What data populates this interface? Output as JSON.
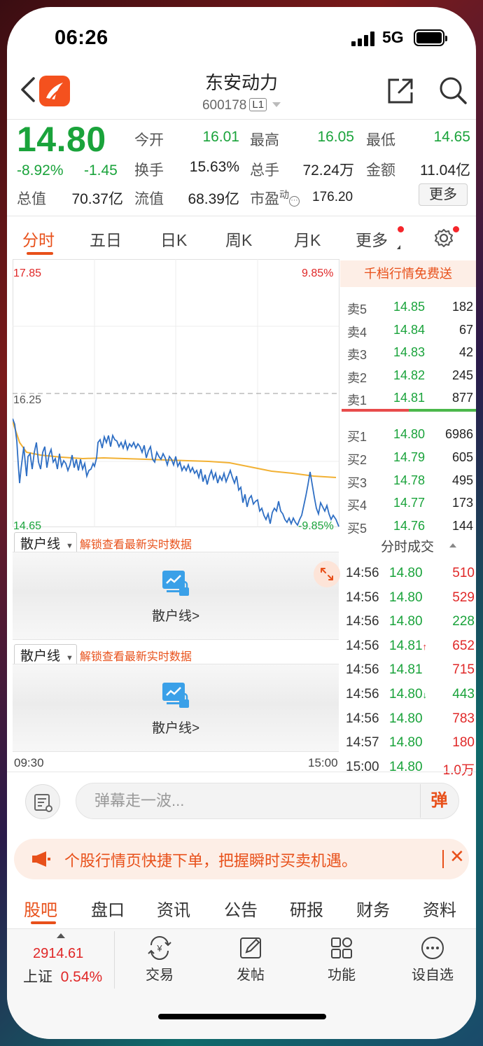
{
  "status": {
    "time": "06:26",
    "network": "5G"
  },
  "header": {
    "title": "东安动力",
    "code": "600178",
    "level": "L1"
  },
  "quote": {
    "price": "14.80",
    "change_pct": "-8.92%",
    "change": "-1.45",
    "fields": [
      {
        "label": "今开",
        "value": "16.01",
        "color": "g"
      },
      {
        "label": "最高",
        "value": "16.05",
        "color": "g"
      },
      {
        "label": "最低",
        "value": "14.65",
        "color": "g"
      },
      {
        "label": "换手",
        "value": "15.63%",
        "color": "k"
      },
      {
        "label": "总手",
        "value": "72.24万",
        "color": "k"
      },
      {
        "label": "金额",
        "value": "11.04亿",
        "color": "k"
      },
      {
        "label": "总值",
        "value": "70.37亿",
        "color": "k"
      },
      {
        "label": "流值",
        "value": "68.39亿",
        "color": "k"
      },
      {
        "label": "市盈",
        "sup": "动",
        "value": "176.20",
        "color": "k"
      }
    ],
    "more_label": "更多"
  },
  "tabs": [
    "分时",
    "五日",
    "日K",
    "周K",
    "月K",
    "更多"
  ],
  "chart": {
    "top_price": "17.85",
    "top_pct": "9.85%",
    "mid_price": "16.25",
    "bottom_price": "14.65",
    "bottom_pct": "-9.85%",
    "time_start": "09:30",
    "time_end": "15:00"
  },
  "sub_panels": [
    {
      "selector": "散户线",
      "unlock": "解锁查看最新实时数据",
      "link": "散户线>"
    },
    {
      "selector": "散户线",
      "unlock": "解锁查看最新实时数据",
      "link": "散户线>"
    }
  ],
  "orderbook": {
    "banner": "千档行情免费送",
    "asks": [
      {
        "label": "卖5",
        "price": "14.85",
        "vol": "182"
      },
      {
        "label": "卖4",
        "price": "14.84",
        "vol": "67"
      },
      {
        "label": "卖3",
        "price": "14.83",
        "vol": "42"
      },
      {
        "label": "卖2",
        "price": "14.82",
        "vol": "245"
      },
      {
        "label": "卖1",
        "price": "14.81",
        "vol": "877"
      }
    ],
    "bids": [
      {
        "label": "买1",
        "price": "14.80",
        "vol": "6986"
      },
      {
        "label": "买2",
        "price": "14.79",
        "vol": "605"
      },
      {
        "label": "买3",
        "price": "14.78",
        "vol": "495"
      },
      {
        "label": "买4",
        "price": "14.77",
        "vol": "173"
      },
      {
        "label": "买5",
        "price": "14.76",
        "vol": "144"
      }
    ]
  },
  "ticks": {
    "title": "分时成交",
    "rows": [
      {
        "time": "14:56",
        "price": "14.80",
        "arrow": "",
        "vol": "510",
        "color": "r"
      },
      {
        "time": "14:56",
        "price": "14.80",
        "arrow": "",
        "vol": "529",
        "color": "r"
      },
      {
        "time": "14:56",
        "price": "14.80",
        "arrow": "",
        "vol": "228",
        "color": "g"
      },
      {
        "time": "14:56",
        "price": "14.81",
        "arrow": "↑",
        "vol": "652",
        "color": "r"
      },
      {
        "time": "14:56",
        "price": "14.81",
        "arrow": "",
        "vol": "715",
        "color": "r"
      },
      {
        "time": "14:56",
        "price": "14.80",
        "arrow": "↓",
        "vol": "443",
        "color": "g"
      },
      {
        "time": "14:56",
        "price": "14.80",
        "arrow": "",
        "vol": "783",
        "color": "r"
      },
      {
        "time": "14:57",
        "price": "14.80",
        "arrow": "",
        "vol": "180",
        "color": "r"
      },
      {
        "time": "15:00",
        "price": "14.80",
        "arrow": "",
        "vol": "1.0万",
        "color": "r"
      }
    ]
  },
  "danmu": {
    "placeholder": "弹幕走一波...",
    "send": "弹"
  },
  "notice": {
    "text": "个股行情页快捷下单，把握瞬时买卖机遇。"
  },
  "bottom_tabs": [
    "股吧",
    "盘口",
    "资讯",
    "公告",
    "研报",
    "财务",
    "资料"
  ],
  "nav": {
    "index_value": "2914.61",
    "index_name": "上证",
    "index_pct": "0.54%",
    "items": [
      {
        "label": "交易",
        "icon": "trade-icon"
      },
      {
        "label": "发帖",
        "icon": "post-icon"
      },
      {
        "label": "功能",
        "icon": "apps-icon"
      },
      {
        "label": "设自选",
        "icon": "more-icon"
      }
    ]
  },
  "colors": {
    "up": "#e02828",
    "down": "#1aa33b",
    "accent": "#e8501a",
    "price_line": "#2f6fc4",
    "avg_line": "#f2b134"
  }
}
